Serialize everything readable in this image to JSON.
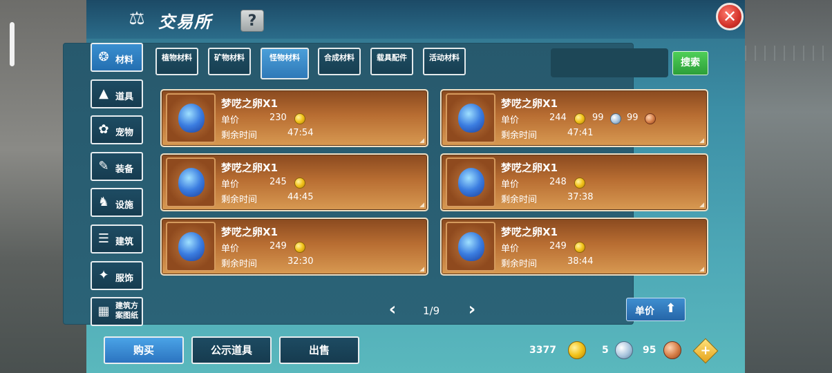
{
  "window": {
    "title": "交易所",
    "help_label": "?",
    "close_label": "✕"
  },
  "categories": [
    {
      "label": "材料",
      "icon": "materials-icon",
      "glyph": "❂",
      "active": true
    },
    {
      "label": "道具",
      "icon": "potion-icon",
      "glyph": "▲",
      "active": false
    },
    {
      "label": "宠物",
      "icon": "paw-icon",
      "glyph": "✿",
      "active": false
    },
    {
      "label": "装备",
      "icon": "equipment-icon",
      "glyph": "✎",
      "active": false
    },
    {
      "label": "设施",
      "icon": "facility-icon",
      "glyph": "♞",
      "active": false
    },
    {
      "label": "建筑",
      "icon": "building-icon",
      "glyph": "☰",
      "active": false
    },
    {
      "label": "服饰",
      "icon": "clothing-icon",
      "glyph": "✦",
      "active": false
    },
    {
      "label": "建筑方案图纸",
      "icon": "blueprint-icon",
      "glyph": "▦",
      "active": false
    }
  ],
  "subtabs": [
    {
      "label": "植物材料",
      "active": false
    },
    {
      "label": "矿物材料",
      "active": false
    },
    {
      "label": "怪物材料",
      "active": true
    },
    {
      "label": "合成材料",
      "active": false
    },
    {
      "label": "载具配件",
      "active": false
    },
    {
      "label": "活动材料",
      "active": false
    }
  ],
  "search": {
    "placeholder": "",
    "button_label": "搜索"
  },
  "listing_labels": {
    "price": "单价",
    "time_left": "剩余时间"
  },
  "listings": [
    {
      "name": "梦呓之卵X1",
      "price_gold": "230",
      "time_left": "47:54"
    },
    {
      "name": "梦呓之卵X1",
      "price_gold": "244",
      "price_silver": "99",
      "price_copper": "99",
      "time_left": "47:41"
    },
    {
      "name": "梦呓之卵X1",
      "price_gold": "245",
      "time_left": "44:45"
    },
    {
      "name": "梦呓之卵X1",
      "price_gold": "248",
      "time_left": "37:38"
    },
    {
      "name": "梦呓之卵X1",
      "price_gold": "249",
      "time_left": "32:30"
    },
    {
      "name": "梦呓之卵X1",
      "price_gold": "249",
      "time_left": "38:44"
    }
  ],
  "pagination": {
    "current": "1/9",
    "prev": "‹",
    "next": "›"
  },
  "sort": {
    "label": "单价"
  },
  "actions": {
    "buy": "购买",
    "public_items": "公示道具",
    "sell": "出售"
  },
  "currency": {
    "gold": "3377",
    "silver": "5",
    "copper": "95",
    "add_label": "+"
  }
}
